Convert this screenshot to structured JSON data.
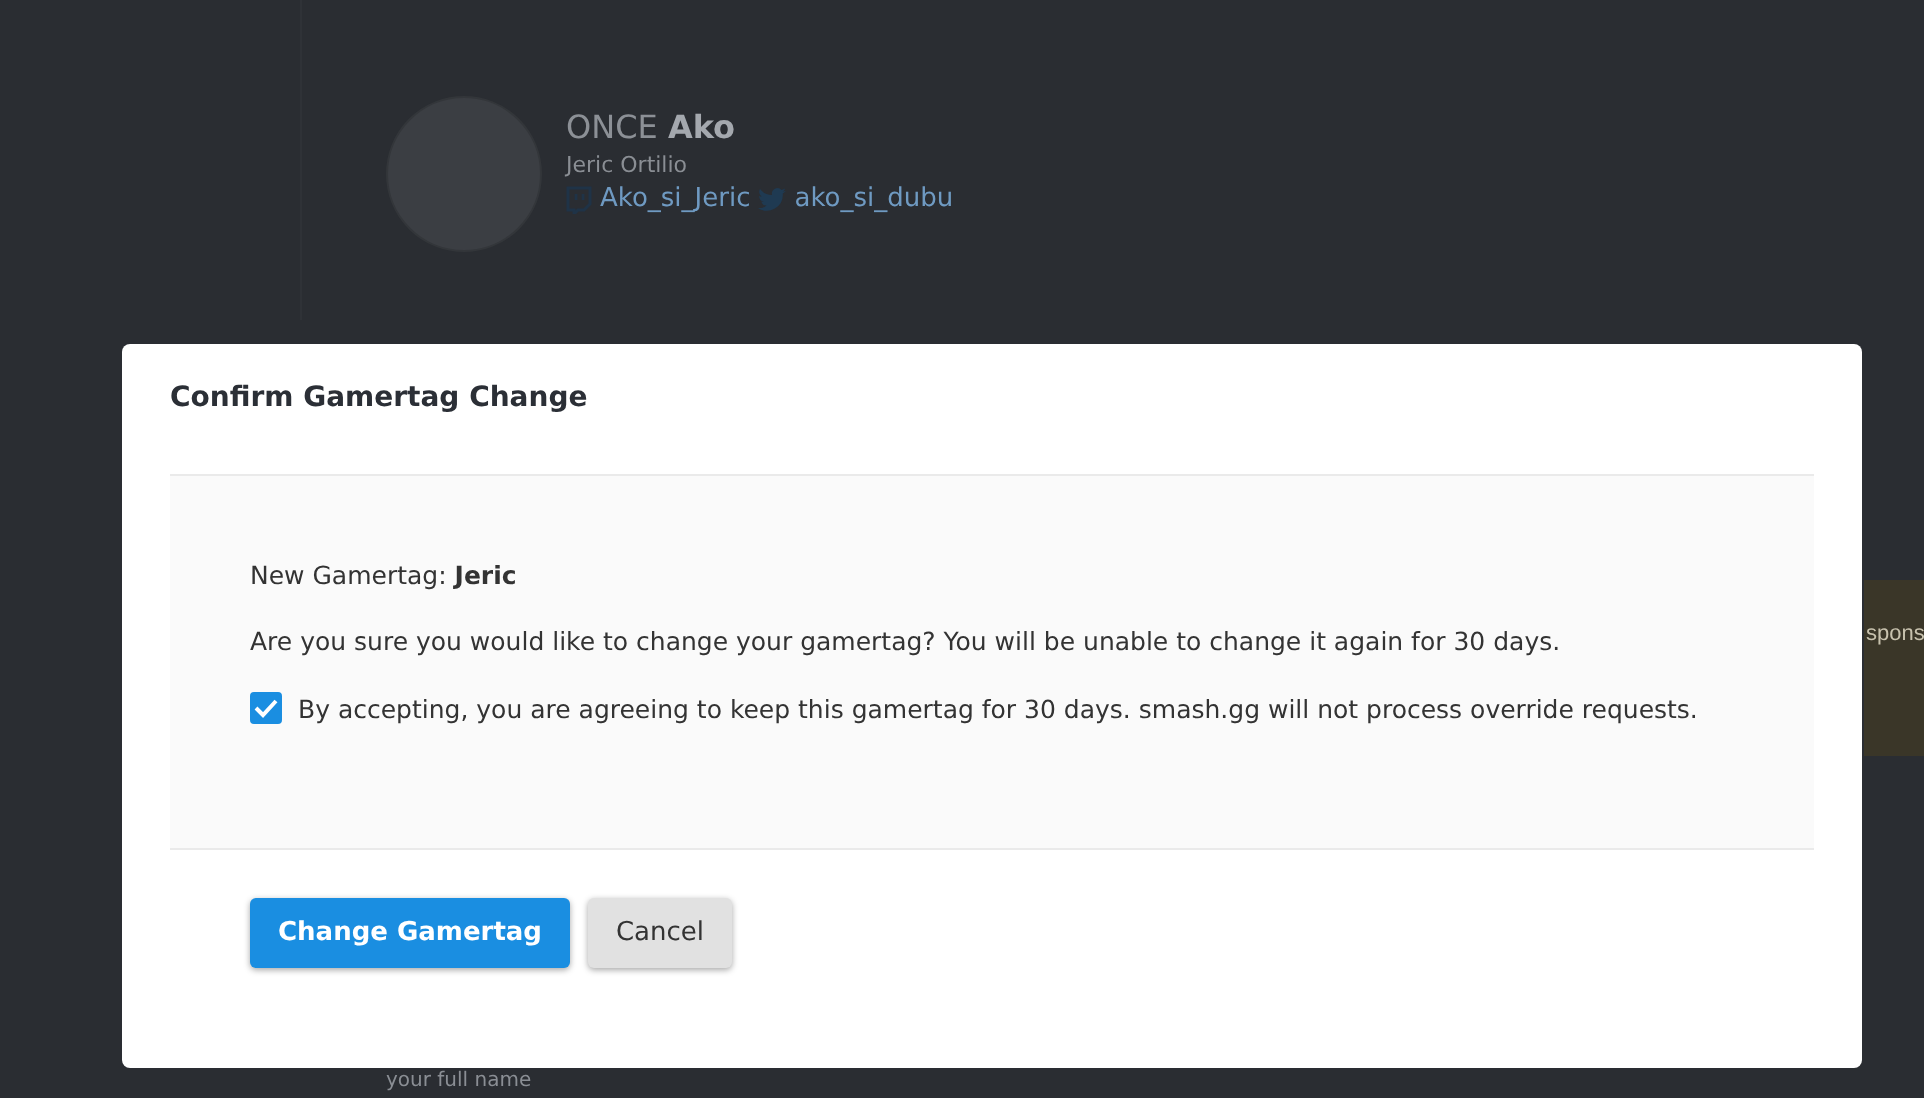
{
  "profile": {
    "prefix": "ONCE",
    "gamertag": "Ako",
    "full_name": "Jeric Ortilio",
    "twitch": "Ako_si_Jeric",
    "twitter": "ako_si_dubu"
  },
  "background_texts": {
    "side_fragment": "spons",
    "bottom_fragment": "your full name"
  },
  "dialog": {
    "title": "Confirm Gamertag Change",
    "new_gamertag_label": "New Gamertag:",
    "new_gamertag": "Jeric",
    "question": "Are you sure you would like to change your gamertag? You will be unable to change it again for 30 days.",
    "agreement": {
      "label": "By accepting, you are agreeing to keep this gamertag for 30 days. smash.gg will not process override requests.",
      "checked": true
    },
    "buttons": [
      {
        "label": "Change Gamertag",
        "kind": "primary"
      },
      {
        "label": "Cancel",
        "kind": "secondary"
      }
    ]
  }
}
